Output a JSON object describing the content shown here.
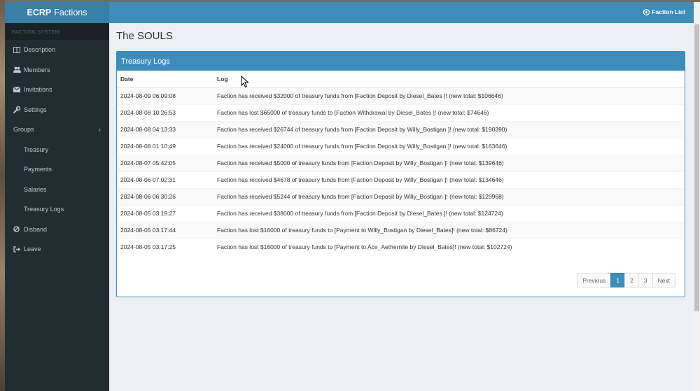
{
  "brand": {
    "bold": "ECRP",
    "rest": "Factions"
  },
  "sidebar": {
    "header": "FACTION SYSTEM",
    "items": [
      {
        "label": "Description",
        "icon": "columns-icon"
      },
      {
        "label": "Members",
        "icon": "users-icon"
      },
      {
        "label": "Invitations",
        "icon": "envelope-icon"
      },
      {
        "label": "Settings",
        "icon": "wrench-icon"
      }
    ],
    "group": {
      "label": "Groups",
      "chevron": "‹"
    },
    "subitems": [
      "Treasury",
      "Payments",
      "Salaries",
      "Treasury Logs"
    ],
    "bottom": [
      {
        "label": "Disband",
        "icon": "ban-icon"
      },
      {
        "label": "Leave",
        "icon": "sign-out-icon"
      }
    ]
  },
  "header": {
    "faction_list": "Faction List"
  },
  "page": {
    "title": "The SOULS"
  },
  "panel": {
    "title": "Treasury Logs",
    "columns": [
      "Date",
      "Log"
    ],
    "rows": [
      {
        "date": "2024-08-09 06:09:08",
        "log": "Faction has received $32000 of treasury funds from [Faction Deposit by Diesel_Bates ]! (new total: $106646)"
      },
      {
        "date": "2024-08-08 10:26:53",
        "log": "Faction has lost $65000 of treasury funds to [Faction Withdrawal by Diesel_Bates ]! (new total: $74646)"
      },
      {
        "date": "2024-08-08 04:13:33",
        "log": "Faction has received $26744 of treasury funds from [Faction Deposit by Willy_Bostigan ]! (new total: $190390)"
      },
      {
        "date": "2024-08-08 01:10:49",
        "log": "Faction has received $24000 of treasury funds from [Faction Deposit by Willy_Bostigan ]! (new total: $163646)"
      },
      {
        "date": "2024-08-07 05:42:05",
        "log": "Faction has received $5000 of treasury funds from [Faction Deposit by Willy_Bostigan ]! (new total: $139646)"
      },
      {
        "date": "2024-08-06 07:02:31",
        "log": "Faction has received $4678 of treasury funds from [Faction Deposit by Willy_Bostigan ]! (new total: $134646)"
      },
      {
        "date": "2024-08-06 06:30:26",
        "log": "Faction has received $5244 of treasury funds from [Faction Deposit by Willy_Bostigan ]! (new total: $129968)"
      },
      {
        "date": "2024-08-05 03:19:27",
        "log": "Faction has received $38000 of treasury funds from [Faction Deposit by Diesel_Bates ]! (new total: $124724)"
      },
      {
        "date": "2024-08-05 03:17:44",
        "log": "Faction has lost $16000 of treasury funds to [Payment to Willy_Bostigan by Diesel_Bates]! (new total: $86724)"
      },
      {
        "date": "2024-08-05 03:17:25",
        "log": "Faction has lost $16000 of treasury funds to [Payment to Ace_Aethernite by Diesel_Bates]! (new total: $102724)"
      }
    ]
  },
  "pagination": {
    "previous": "Previous",
    "pages": [
      "1",
      "2",
      "3"
    ],
    "active": "1",
    "next": "Next"
  },
  "colors": {
    "brand": "#367fa9",
    "header": "#3c8dbc",
    "sidebar": "#222d32"
  }
}
